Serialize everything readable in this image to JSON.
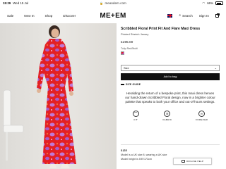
{
  "status_bar": {
    "time": "15:29",
    "date": "Wed 15 Jul",
    "url": "meandem.com",
    "battery": "66%"
  },
  "nav": {
    "links": [
      "Sale",
      "New In",
      "Shop",
      "Discover"
    ],
    "logo": "ME+EM",
    "search_label": "Search",
    "signin_label": "Sign In"
  },
  "product": {
    "title": "Scribbled Floral Print Fit And Flare Maxi Dress",
    "subtitle": "Printed Stretch Jersey",
    "price": "£195.00",
    "colour": "Tulip Red/Multi",
    "size_placeholder": "Size",
    "add_to_bag": "Add to bag",
    "size_guide": "SIZE GUIDE",
    "description": "Heralding the return of a bespoke print, this maxi dress heroes our hand-drawn Scribbled Floral design, now in a brighter colour palette that speaks to both your office and out-of-hours settings.",
    "features": [
      {
        "label": "FIT",
        "icon": "hanger-icon"
      },
      {
        "label": "FABRIC",
        "icon": "fabric-icon"
      },
      {
        "label": "FOREVER",
        "icon": "forever-icon"
      }
    ]
  },
  "size_info": {
    "heading": "SIZE",
    "line1": "Model is a UK size 8, wearing a UK size",
    "line2": "Model height is 5'8\"/173cm"
  },
  "chat": {
    "label": "OFFLINE HELP"
  },
  "colors": {
    "dress_red": "#e32024",
    "dress_violet": "#c07ad6",
    "button_bg": "#111111"
  }
}
